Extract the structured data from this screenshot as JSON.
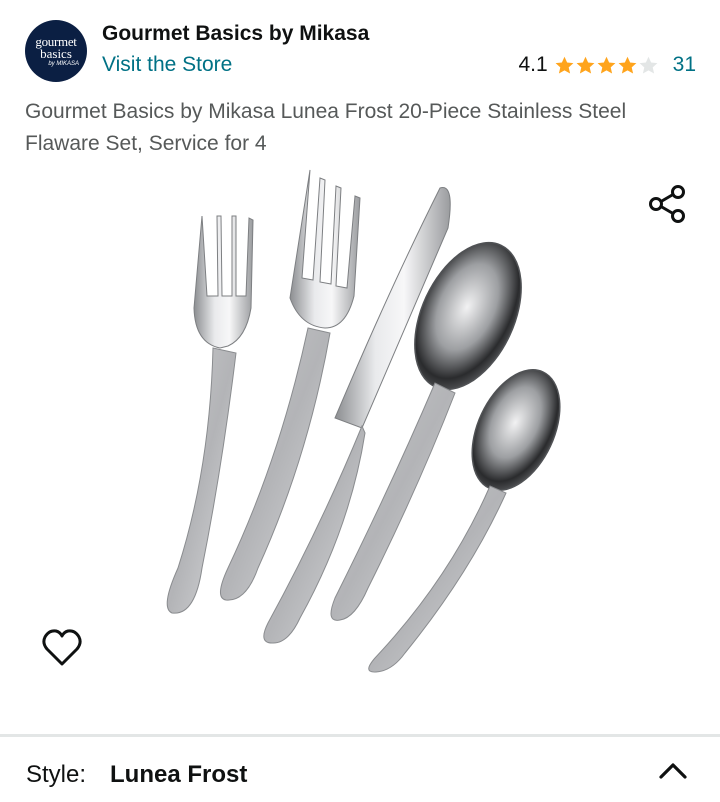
{
  "store": {
    "logo_text_line1": "gourmet",
    "logo_text_line2": "basics",
    "logo_text_line3": "by MIKASA",
    "name": "Gourmet Basics by Mikasa",
    "visit_label": "Visit the Store"
  },
  "rating": {
    "value": "4.1",
    "out_of": 5,
    "count": "31"
  },
  "product": {
    "title": "Gourmet Basics by Mikasa Lunea Frost 20-Piece Stainless Steel Flaware Set, Service for 4"
  },
  "icons": {
    "share": "share-icon",
    "wishlist": "heart-outline-icon",
    "collapse": "chevron-up-icon"
  },
  "variation": {
    "label": "Style:",
    "value": "Lunea Frost"
  },
  "colors": {
    "link": "#007185",
    "star": "#ffa41c",
    "star_empty": "#d5d9d9",
    "text": "#0f1111",
    "muted_text": "#565959",
    "logo_bg": "#0b1f43"
  }
}
